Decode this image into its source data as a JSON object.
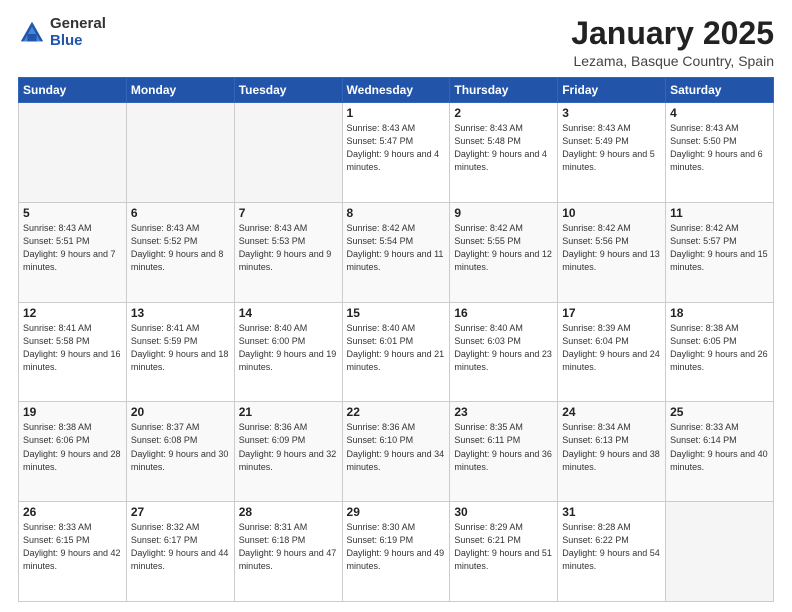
{
  "logo": {
    "general": "General",
    "blue": "Blue"
  },
  "header": {
    "title": "January 2025",
    "subtitle": "Lezama, Basque Country, Spain"
  },
  "weekdays": [
    "Sunday",
    "Monday",
    "Tuesday",
    "Wednesday",
    "Thursday",
    "Friday",
    "Saturday"
  ],
  "weeks": [
    [
      {
        "day": "",
        "info": ""
      },
      {
        "day": "",
        "info": ""
      },
      {
        "day": "",
        "info": ""
      },
      {
        "day": "1",
        "info": "Sunrise: 8:43 AM\nSunset: 5:47 PM\nDaylight: 9 hours\nand 4 minutes."
      },
      {
        "day": "2",
        "info": "Sunrise: 8:43 AM\nSunset: 5:48 PM\nDaylight: 9 hours\nand 4 minutes."
      },
      {
        "day": "3",
        "info": "Sunrise: 8:43 AM\nSunset: 5:49 PM\nDaylight: 9 hours\nand 5 minutes."
      },
      {
        "day": "4",
        "info": "Sunrise: 8:43 AM\nSunset: 5:50 PM\nDaylight: 9 hours\nand 6 minutes."
      }
    ],
    [
      {
        "day": "5",
        "info": "Sunrise: 8:43 AM\nSunset: 5:51 PM\nDaylight: 9 hours\nand 7 minutes."
      },
      {
        "day": "6",
        "info": "Sunrise: 8:43 AM\nSunset: 5:52 PM\nDaylight: 9 hours\nand 8 minutes."
      },
      {
        "day": "7",
        "info": "Sunrise: 8:43 AM\nSunset: 5:53 PM\nDaylight: 9 hours\nand 9 minutes."
      },
      {
        "day": "8",
        "info": "Sunrise: 8:42 AM\nSunset: 5:54 PM\nDaylight: 9 hours\nand 11 minutes."
      },
      {
        "day": "9",
        "info": "Sunrise: 8:42 AM\nSunset: 5:55 PM\nDaylight: 9 hours\nand 12 minutes."
      },
      {
        "day": "10",
        "info": "Sunrise: 8:42 AM\nSunset: 5:56 PM\nDaylight: 9 hours\nand 13 minutes."
      },
      {
        "day": "11",
        "info": "Sunrise: 8:42 AM\nSunset: 5:57 PM\nDaylight: 9 hours\nand 15 minutes."
      }
    ],
    [
      {
        "day": "12",
        "info": "Sunrise: 8:41 AM\nSunset: 5:58 PM\nDaylight: 9 hours\nand 16 minutes."
      },
      {
        "day": "13",
        "info": "Sunrise: 8:41 AM\nSunset: 5:59 PM\nDaylight: 9 hours\nand 18 minutes."
      },
      {
        "day": "14",
        "info": "Sunrise: 8:40 AM\nSunset: 6:00 PM\nDaylight: 9 hours\nand 19 minutes."
      },
      {
        "day": "15",
        "info": "Sunrise: 8:40 AM\nSunset: 6:01 PM\nDaylight: 9 hours\nand 21 minutes."
      },
      {
        "day": "16",
        "info": "Sunrise: 8:40 AM\nSunset: 6:03 PM\nDaylight: 9 hours\nand 23 minutes."
      },
      {
        "day": "17",
        "info": "Sunrise: 8:39 AM\nSunset: 6:04 PM\nDaylight: 9 hours\nand 24 minutes."
      },
      {
        "day": "18",
        "info": "Sunrise: 8:38 AM\nSunset: 6:05 PM\nDaylight: 9 hours\nand 26 minutes."
      }
    ],
    [
      {
        "day": "19",
        "info": "Sunrise: 8:38 AM\nSunset: 6:06 PM\nDaylight: 9 hours\nand 28 minutes."
      },
      {
        "day": "20",
        "info": "Sunrise: 8:37 AM\nSunset: 6:08 PM\nDaylight: 9 hours\nand 30 minutes."
      },
      {
        "day": "21",
        "info": "Sunrise: 8:36 AM\nSunset: 6:09 PM\nDaylight: 9 hours\nand 32 minutes."
      },
      {
        "day": "22",
        "info": "Sunrise: 8:36 AM\nSunset: 6:10 PM\nDaylight: 9 hours\nand 34 minutes."
      },
      {
        "day": "23",
        "info": "Sunrise: 8:35 AM\nSunset: 6:11 PM\nDaylight: 9 hours\nand 36 minutes."
      },
      {
        "day": "24",
        "info": "Sunrise: 8:34 AM\nSunset: 6:13 PM\nDaylight: 9 hours\nand 38 minutes."
      },
      {
        "day": "25",
        "info": "Sunrise: 8:33 AM\nSunset: 6:14 PM\nDaylight: 9 hours\nand 40 minutes."
      }
    ],
    [
      {
        "day": "26",
        "info": "Sunrise: 8:33 AM\nSunset: 6:15 PM\nDaylight: 9 hours\nand 42 minutes."
      },
      {
        "day": "27",
        "info": "Sunrise: 8:32 AM\nSunset: 6:17 PM\nDaylight: 9 hours\nand 44 minutes."
      },
      {
        "day": "28",
        "info": "Sunrise: 8:31 AM\nSunset: 6:18 PM\nDaylight: 9 hours\nand 47 minutes."
      },
      {
        "day": "29",
        "info": "Sunrise: 8:30 AM\nSunset: 6:19 PM\nDaylight: 9 hours\nand 49 minutes."
      },
      {
        "day": "30",
        "info": "Sunrise: 8:29 AM\nSunset: 6:21 PM\nDaylight: 9 hours\nand 51 minutes."
      },
      {
        "day": "31",
        "info": "Sunrise: 8:28 AM\nSunset: 6:22 PM\nDaylight: 9 hours\nand 54 minutes."
      },
      {
        "day": "",
        "info": ""
      }
    ]
  ]
}
